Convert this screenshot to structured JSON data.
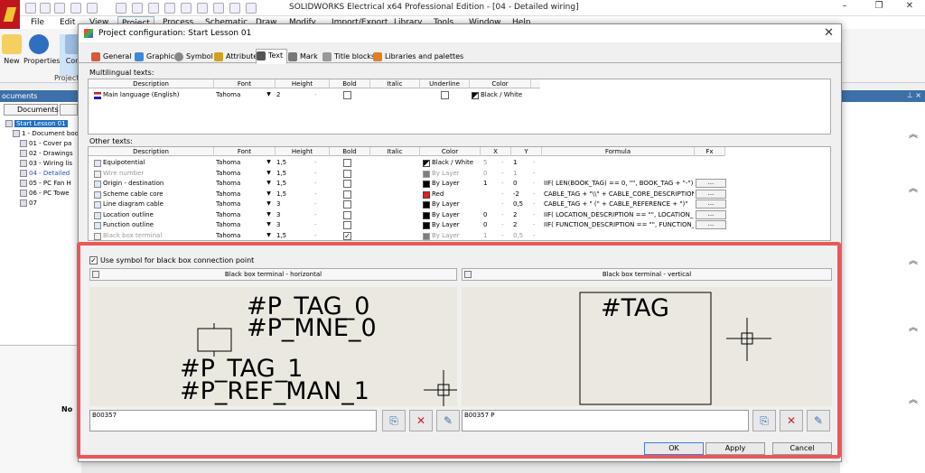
{
  "app": {
    "title": "SOLIDWORKS Electrical x64 Professional Edition - [04 - Detailed wiring]",
    "menu": [
      "File",
      "Edit",
      "View",
      "Project",
      "Process",
      "Schematic",
      "Draw",
      "Modify",
      "Import/Export",
      "Library",
      "Tools",
      "Window",
      "Help"
    ],
    "active_menu": "Project",
    "ribbon": {
      "new_label": "New",
      "properties_label": "Properties",
      "config_label": "Confi",
      "group_label": "Project"
    },
    "left_panel": {
      "header": "ocuments",
      "tab_label": "Documents",
      "tree": [
        {
          "label": "Start Lesson 01",
          "state": "selected"
        },
        {
          "label": "1 - Document boo",
          "state": ""
        },
        {
          "label": "01 - Cover pa",
          "state": ""
        },
        {
          "label": "02 - Drawings",
          "state": ""
        },
        {
          "label": "03 - Wiring lis",
          "state": ""
        },
        {
          "label": "04 - Detailed",
          "state": "blue"
        },
        {
          "label": "05 - PC Fan H",
          "state": ""
        },
        {
          "label": "06 - PC Towe",
          "state": ""
        },
        {
          "label": "07",
          "state": ""
        }
      ],
      "lower_text": "No"
    }
  },
  "dialog": {
    "title": "Project configuration: Start Lesson 01",
    "tabs": [
      {
        "label": "General",
        "color": "#d85a3a"
      },
      {
        "label": "Graphic",
        "color": "#3b8ad8"
      },
      {
        "label": "Symbol",
        "color": "#888888"
      },
      {
        "label": "Attribute",
        "color": "#d0a020"
      },
      {
        "label": "Text",
        "color": "#555555"
      },
      {
        "label": "Mark",
        "color": "#777777"
      },
      {
        "label": "Title blocks",
        "color": "#999999"
      },
      {
        "label": "Libraries and palettes",
        "color": "#e08020"
      }
    ],
    "active_tab": "Text",
    "multilingual": {
      "label": "Multilingual texts:",
      "headers": [
        "Description",
        "Font",
        "Height",
        "Bold",
        "Italic",
        "Underline",
        "Color"
      ],
      "rows": [
        {
          "description": "Main language (English)",
          "font": "Tahoma",
          "height": "2",
          "bold_dash": "-",
          "color": "Black / White"
        }
      ]
    },
    "other": {
      "label": "Other texts:",
      "headers": [
        "Description",
        "Font",
        "Height",
        "Bold",
        "Italic",
        "Color",
        "X",
        "Y",
        "Formula",
        "Fx"
      ],
      "rows": [
        {
          "description": "Equipotential",
          "font": "Tahoma",
          "height": "1,5",
          "color": "Black / White",
          "swatch": "#000000",
          "x": "5",
          "y": "1",
          "formula": "",
          "grey": false,
          "color_grey": true,
          "x_grey": true,
          "fx": false,
          "bold_checked": false
        },
        {
          "description": "Wire number",
          "font": "Tahoma",
          "height": "1,5",
          "color": "By Layer",
          "swatch": "#000000",
          "x": "0",
          "y": "1",
          "formula": "",
          "grey": true,
          "color_grey": true,
          "x_grey": true,
          "fx": false,
          "bold_checked": false
        },
        {
          "description": "Origin - destination",
          "font": "Tahoma",
          "height": "1,5",
          "color": "By Layer",
          "swatch": "#000000",
          "x": "1",
          "y": "0",
          "formula": "IIF( LEN(BOOK_TAG) == 0, \"\", BOOK_TAG + \"-\") + ...",
          "grey": false,
          "color_grey": false,
          "x_grey": false,
          "fx": true,
          "bold_checked": false
        },
        {
          "description": "Scheme cable core",
          "font": "Tahoma",
          "height": "1,5",
          "color": "Red",
          "swatch": "#e02020",
          "x": "",
          "y": "-2",
          "formula": "CABLE_TAG + \"\\\\\" + CABLE_CORE_DESCRIPTION",
          "grey": false,
          "color_grey": false,
          "x_grey": false,
          "fx": true,
          "bold_checked": false
        },
        {
          "description": "Line diagram cable",
          "font": "Tahoma",
          "height": "3",
          "color": "By Layer",
          "swatch": "#000000",
          "x": "",
          "y": "0,5",
          "formula": "CABLE_TAG + \" (\" + CABLE_REFERENCE + \")\"",
          "grey": false,
          "color_grey": false,
          "x_grey": false,
          "fx": true,
          "bold_checked": false
        },
        {
          "description": "Location outline",
          "font": "Tahoma",
          "height": "3",
          "color": "By Layer",
          "swatch": "#000000",
          "x": "0",
          "y": "2",
          "formula": "IIF( LOCATION_DESCRIPTION == \"\", LOCATION_...",
          "grey": false,
          "color_grey": false,
          "x_grey": false,
          "fx": true,
          "bold_checked": false
        },
        {
          "description": "Function outline",
          "font": "Tahoma",
          "height": "3",
          "color": "By Layer",
          "swatch": "#000000",
          "x": "0",
          "y": "2",
          "formula": "IIF( FUNCTION_DESCRIPTION == \"\", FUNCTION_...",
          "grey": false,
          "color_grey": false,
          "x_grey": false,
          "fx": true,
          "bold_checked": false
        },
        {
          "description": "Black box terminal",
          "font": "Tahoma",
          "height": "1,5",
          "color": "By Layer",
          "swatch": "#000000",
          "x": "1",
          "y": "0,5",
          "formula": "",
          "grey": true,
          "color_grey": true,
          "x_grey": true,
          "fx": false,
          "bold_checked": true
        }
      ]
    },
    "use_symbol_label": "Use symbol for black box connection point",
    "horizontal": {
      "title": "Black box terminal - horizontal",
      "texts": [
        "#P_TAG_0",
        "#P_MNE_0",
        "#P_TAG_1",
        "#P_REF_MAN_1"
      ],
      "code": "B00357"
    },
    "vertical": {
      "title": "Black box terminal - vertical",
      "tag": "#TAG",
      "code": "B00357 P"
    },
    "buttons": {
      "ok": "OK",
      "apply": "Apply",
      "cancel": "Cancel"
    },
    "fx_label": "...",
    "dash": "-",
    "dropdown_arrow": "▼",
    "check_mark": "✓",
    "close_glyph": "✕",
    "accent_color": "#e8585a"
  }
}
